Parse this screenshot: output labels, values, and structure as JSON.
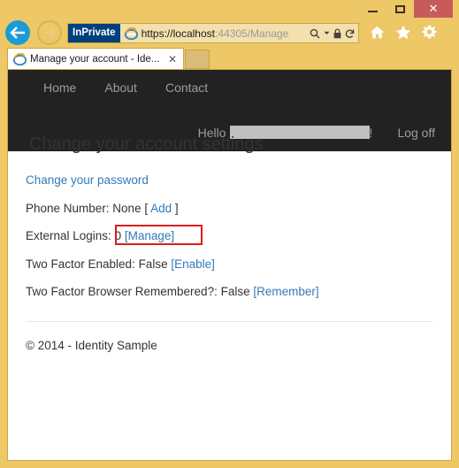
{
  "window": {
    "minimize_label": "–",
    "maximize_label": "",
    "close_label": "✕"
  },
  "browser": {
    "back_icon": "back-arrow-icon",
    "forward_icon": "forward-arrow-icon",
    "inprivate_badge": "InPrivate",
    "url_scheme": "https://",
    "url_host": "localhost",
    "url_rest": ":44305/Manage",
    "search_icon": "⌕",
    "dropdown_icon": "▾",
    "lock_icon": "■",
    "refresh_icon": "↻",
    "home_icon": "home-icon",
    "favorites_icon": "★",
    "tools_icon": "gear-icon",
    "tab_title": "Manage your account - Ide...",
    "tab_close": "✕"
  },
  "site": {
    "nav": [
      {
        "label": "Home"
      },
      {
        "label": "About"
      },
      {
        "label": "Contact"
      }
    ],
    "greeting": "Hello",
    "greeting_suffix": "!",
    "logoff": "Log off"
  },
  "page": {
    "heading": "Change your account settings",
    "change_password_link": "Change your password",
    "rows": {
      "phone_label": "Phone Number: None [",
      "phone_link": "Add",
      "phone_close": "]",
      "external_label": "External Logins:",
      "external_count": "0",
      "external_link": "[Manage]",
      "twofactor_label": "Two Factor Enabled: False",
      "twofactor_link": "[Enable]",
      "remembered_label": "Two Factor Browser Remembered?: False",
      "remembered_link": "[Remember]"
    },
    "footer": "© 2014 - Identity Sample"
  },
  "colors": {
    "chrome": "#eec866",
    "navbar_dark": "#222222",
    "link_blue": "#337ab7",
    "highlight_red": "#e01b1b",
    "inprivate_blue": "#003f7d",
    "close_red": "#c75b5b"
  }
}
